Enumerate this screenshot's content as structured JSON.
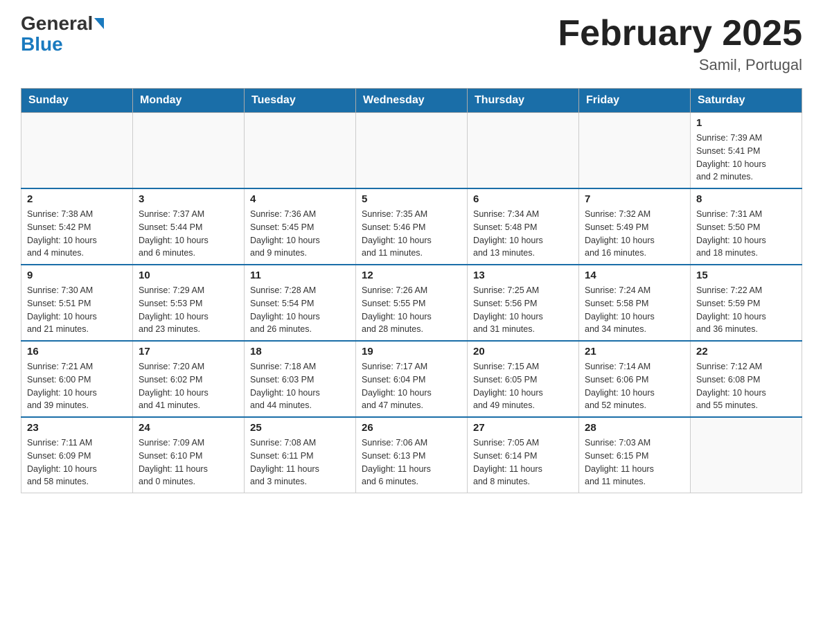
{
  "logo": {
    "part1": "General",
    "part2": "Blue"
  },
  "title": "February 2025",
  "subtitle": "Samil, Portugal",
  "days_of_week": [
    "Sunday",
    "Monday",
    "Tuesday",
    "Wednesday",
    "Thursday",
    "Friday",
    "Saturday"
  ],
  "weeks": [
    [
      {
        "day": "",
        "info": ""
      },
      {
        "day": "",
        "info": ""
      },
      {
        "day": "",
        "info": ""
      },
      {
        "day": "",
        "info": ""
      },
      {
        "day": "",
        "info": ""
      },
      {
        "day": "",
        "info": ""
      },
      {
        "day": "1",
        "info": "Sunrise: 7:39 AM\nSunset: 5:41 PM\nDaylight: 10 hours\nand 2 minutes."
      }
    ],
    [
      {
        "day": "2",
        "info": "Sunrise: 7:38 AM\nSunset: 5:42 PM\nDaylight: 10 hours\nand 4 minutes."
      },
      {
        "day": "3",
        "info": "Sunrise: 7:37 AM\nSunset: 5:44 PM\nDaylight: 10 hours\nand 6 minutes."
      },
      {
        "day": "4",
        "info": "Sunrise: 7:36 AM\nSunset: 5:45 PM\nDaylight: 10 hours\nand 9 minutes."
      },
      {
        "day": "5",
        "info": "Sunrise: 7:35 AM\nSunset: 5:46 PM\nDaylight: 10 hours\nand 11 minutes."
      },
      {
        "day": "6",
        "info": "Sunrise: 7:34 AM\nSunset: 5:48 PM\nDaylight: 10 hours\nand 13 minutes."
      },
      {
        "day": "7",
        "info": "Sunrise: 7:32 AM\nSunset: 5:49 PM\nDaylight: 10 hours\nand 16 minutes."
      },
      {
        "day": "8",
        "info": "Sunrise: 7:31 AM\nSunset: 5:50 PM\nDaylight: 10 hours\nand 18 minutes."
      }
    ],
    [
      {
        "day": "9",
        "info": "Sunrise: 7:30 AM\nSunset: 5:51 PM\nDaylight: 10 hours\nand 21 minutes."
      },
      {
        "day": "10",
        "info": "Sunrise: 7:29 AM\nSunset: 5:53 PM\nDaylight: 10 hours\nand 23 minutes."
      },
      {
        "day": "11",
        "info": "Sunrise: 7:28 AM\nSunset: 5:54 PM\nDaylight: 10 hours\nand 26 minutes."
      },
      {
        "day": "12",
        "info": "Sunrise: 7:26 AM\nSunset: 5:55 PM\nDaylight: 10 hours\nand 28 minutes."
      },
      {
        "day": "13",
        "info": "Sunrise: 7:25 AM\nSunset: 5:56 PM\nDaylight: 10 hours\nand 31 minutes."
      },
      {
        "day": "14",
        "info": "Sunrise: 7:24 AM\nSunset: 5:58 PM\nDaylight: 10 hours\nand 34 minutes."
      },
      {
        "day": "15",
        "info": "Sunrise: 7:22 AM\nSunset: 5:59 PM\nDaylight: 10 hours\nand 36 minutes."
      }
    ],
    [
      {
        "day": "16",
        "info": "Sunrise: 7:21 AM\nSunset: 6:00 PM\nDaylight: 10 hours\nand 39 minutes."
      },
      {
        "day": "17",
        "info": "Sunrise: 7:20 AM\nSunset: 6:02 PM\nDaylight: 10 hours\nand 41 minutes."
      },
      {
        "day": "18",
        "info": "Sunrise: 7:18 AM\nSunset: 6:03 PM\nDaylight: 10 hours\nand 44 minutes."
      },
      {
        "day": "19",
        "info": "Sunrise: 7:17 AM\nSunset: 6:04 PM\nDaylight: 10 hours\nand 47 minutes."
      },
      {
        "day": "20",
        "info": "Sunrise: 7:15 AM\nSunset: 6:05 PM\nDaylight: 10 hours\nand 49 minutes."
      },
      {
        "day": "21",
        "info": "Sunrise: 7:14 AM\nSunset: 6:06 PM\nDaylight: 10 hours\nand 52 minutes."
      },
      {
        "day": "22",
        "info": "Sunrise: 7:12 AM\nSunset: 6:08 PM\nDaylight: 10 hours\nand 55 minutes."
      }
    ],
    [
      {
        "day": "23",
        "info": "Sunrise: 7:11 AM\nSunset: 6:09 PM\nDaylight: 10 hours\nand 58 minutes."
      },
      {
        "day": "24",
        "info": "Sunrise: 7:09 AM\nSunset: 6:10 PM\nDaylight: 11 hours\nand 0 minutes."
      },
      {
        "day": "25",
        "info": "Sunrise: 7:08 AM\nSunset: 6:11 PM\nDaylight: 11 hours\nand 3 minutes."
      },
      {
        "day": "26",
        "info": "Sunrise: 7:06 AM\nSunset: 6:13 PM\nDaylight: 11 hours\nand 6 minutes."
      },
      {
        "day": "27",
        "info": "Sunrise: 7:05 AM\nSunset: 6:14 PM\nDaylight: 11 hours\nand 8 minutes."
      },
      {
        "day": "28",
        "info": "Sunrise: 7:03 AM\nSunset: 6:15 PM\nDaylight: 11 hours\nand 11 minutes."
      },
      {
        "day": "",
        "info": ""
      }
    ]
  ]
}
